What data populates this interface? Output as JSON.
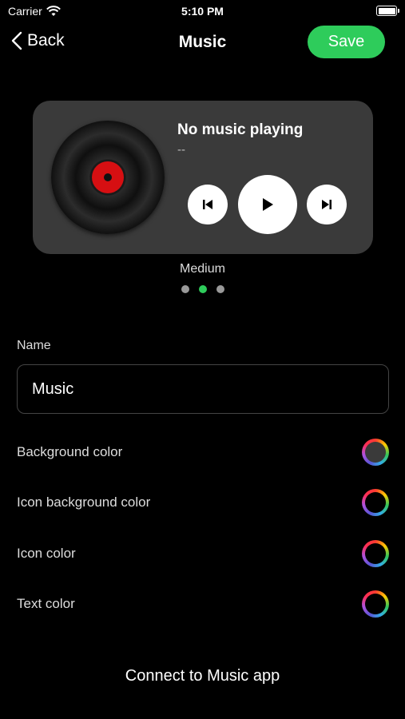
{
  "status_bar": {
    "carrier": "Carrier",
    "time": "5:10 PM"
  },
  "nav": {
    "back_label": "Back",
    "title": "Music",
    "save_label": "Save"
  },
  "widget": {
    "track_title": "No music playing",
    "track_artist": "--",
    "size_label": "Medium",
    "page_count": 3,
    "active_page": 2
  },
  "form": {
    "name_label": "Name",
    "name_value": "Music",
    "color_options": [
      {
        "label": "Background color",
        "inner_color": "#3a3a3a"
      },
      {
        "label": "Icon background color",
        "inner_color": "#000000"
      },
      {
        "label": "Icon color",
        "inner_color": "#000000"
      },
      {
        "label": "Text color",
        "inner_color": "#000000"
      }
    ]
  },
  "connect_label": "Connect to Music app",
  "colors": {
    "accent": "#2ecc5b",
    "widget_bg": "#3a3a3a",
    "vinyl_label": "#d60f12"
  },
  "icons": {
    "wifi": "wifi-icon",
    "battery": "battery-icon",
    "back": "chevron-left-icon",
    "prev": "skip-back-icon",
    "play": "play-icon",
    "next": "skip-forward-icon"
  }
}
